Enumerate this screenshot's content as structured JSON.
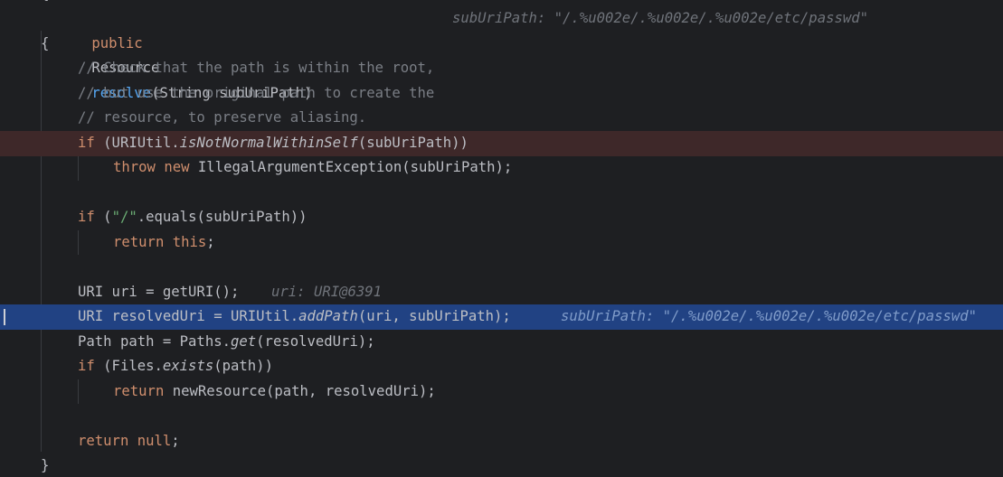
{
  "signature": {
    "kw_public": "public",
    "type": "Resource",
    "method": "resolve",
    "params": "(String subUriPath)",
    "hint": "subUriPath: \"/.%u002e/.%u002e/.%u002e/etc/passwd\""
  },
  "open_brace": "{",
  "comments": [
    "// Check that the path is within the root,",
    "// but use the original path to create the",
    "// resource, to preserve aliasing."
  ],
  "if1": {
    "kw": "if",
    "pre": " (URIUtil.",
    "method": "isNotNormalWithinSelf",
    "post": "(subUriPath))"
  },
  "throw_line": {
    "kw_throw": "throw",
    "kw_new": "new",
    "rest": " IllegalArgumentException(subUriPath);"
  },
  "if2": {
    "kw": "if",
    "pre": " (",
    "str": "\"/\"",
    "post": ".equals(subUriPath))"
  },
  "return_this": {
    "kw_return": "return",
    "kw_this": "this",
    "semi": ";"
  },
  "uri_line": {
    "code": "URI uri = getURI();",
    "hint": "uri: URI@6391"
  },
  "resolved_line": {
    "pre": "URI resolvedUri = URIUtil.",
    "method": "addPath",
    "post": "(uri, subUriPath);",
    "hint": "subUriPath: \"/.%u002e/.%u002e/.%u002e/etc/passwd\""
  },
  "path_line": {
    "pre": "Path path = Paths.",
    "method": "get",
    "post": "(resolvedUri);"
  },
  "if3": {
    "kw": "if",
    "pre": " (Files.",
    "method": "exists",
    "post": "(path))"
  },
  "return_resource": {
    "kw_return": "return",
    "rest": " newResource(path, resolvedUri);"
  },
  "return_null": {
    "kw_return": "return",
    "kw_null": "null",
    "semi": ";"
  },
  "close_brace": "}",
  "colors": {
    "background": "#1e1f22",
    "keyword": "#cf8e6d",
    "method_decl": "#56a8f5",
    "string": "#6aab73",
    "comment": "#7a7e85",
    "breakpoint_line": "#3e2829",
    "execution_line": "#214283"
  }
}
